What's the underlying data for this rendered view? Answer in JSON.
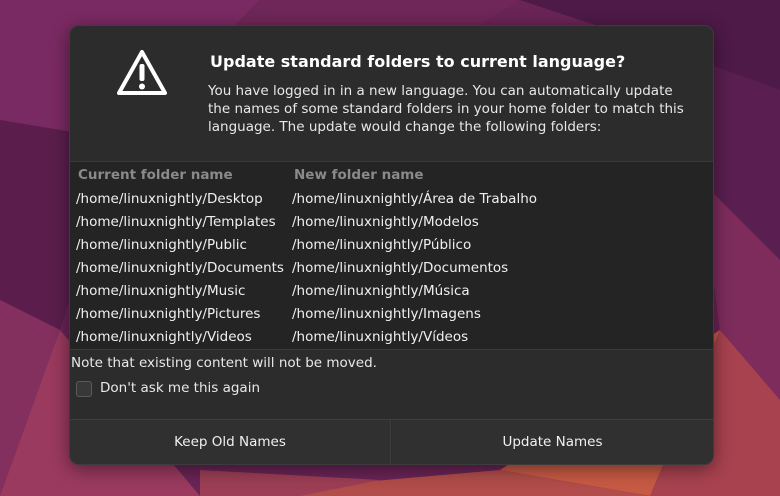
{
  "colors": {
    "dialog_bg": "#2c2c2c",
    "table_bg": "#242424",
    "wallpaper_base": "#5a1f4a"
  },
  "dialog": {
    "icon": "warning-triangle-icon",
    "title": "Update standard folders to current language?",
    "message": "You have logged in in a new language. You can automatically update the names of some standard folders in your home folder to match this language. The update would change the following folders:",
    "table": {
      "headers": [
        "Current folder name",
        "New folder name"
      ],
      "rows": [
        {
          "current": "/home/linuxnightly/Desktop",
          "new": "/home/linuxnightly/Área de Trabalho"
        },
        {
          "current": "/home/linuxnightly/Templates",
          "new": "/home/linuxnightly/Modelos"
        },
        {
          "current": "/home/linuxnightly/Public",
          "new": "/home/linuxnightly/Público"
        },
        {
          "current": "/home/linuxnightly/Documents",
          "new": "/home/linuxnightly/Documentos"
        },
        {
          "current": "/home/linuxnightly/Music",
          "new": "/home/linuxnightly/Música"
        },
        {
          "current": "/home/linuxnightly/Pictures",
          "new": "/home/linuxnightly/Imagens"
        },
        {
          "current": "/home/linuxnightly/Videos",
          "new": "/home/linuxnightly/Vídeos"
        }
      ]
    },
    "note": "Note that existing content will not be moved.",
    "dont_ask": {
      "label": "Don't ask me this again",
      "checked": false
    },
    "buttons": {
      "keep": "Keep Old Names",
      "update": "Update Names"
    }
  }
}
